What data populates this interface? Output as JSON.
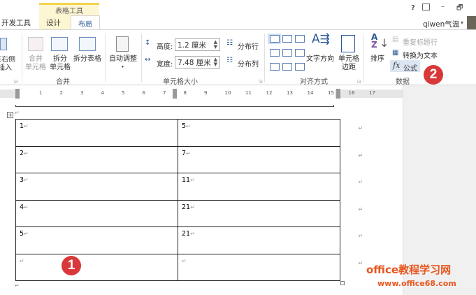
{
  "title_bar": {
    "help": "?",
    "restore_icon": "ribbon-display-icon",
    "minimize": "–",
    "maximize": "🗗",
    "user": "qiwen气温",
    "user_dropdown": "▾"
  },
  "contextual_tab": "表格工具",
  "tabs": [
    {
      "label": "开发工具"
    },
    {
      "label": "设计"
    },
    {
      "label": "布局",
      "selected": true
    }
  ],
  "ribbon": {
    "insert_label": "在右侧插入",
    "merge": {
      "merge_cells": "合并\n单元格",
      "split_cells_1": "拆分",
      "split_cells_2": "单元格",
      "split_table": "拆分表格",
      "group": "合并"
    },
    "cell_size": {
      "autofit": "自动调整",
      "height_label": "高度:",
      "height_value": "1.2 厘米",
      "width_label": "宽度:",
      "width_value": "7.48 厘米",
      "dist_rows": "分布行",
      "dist_cols": "分布列",
      "group": "单元格大小"
    },
    "alignment": {
      "text_direction": "文字方向",
      "cell_margins_1": "单元格",
      "cell_margins_2": "边距",
      "group": "对齐方式"
    },
    "data": {
      "sort": "排序",
      "repeat_header": "重复标题行",
      "convert_text": "转换为文本",
      "formula": "公式",
      "group": "数据"
    }
  },
  "ruler": {
    "numbers": [
      "1",
      "2",
      "3",
      "4",
      "5",
      "6",
      "7",
      "8",
      "9",
      "10",
      "11",
      "12",
      "13",
      "14",
      "15",
      "16",
      "17"
    ]
  },
  "table": {
    "rows": [
      [
        "1",
        "5"
      ],
      [
        "2",
        "7"
      ],
      [
        "3",
        "11"
      ],
      [
        "4",
        "21"
      ],
      [
        "5",
        "21"
      ],
      [
        "",
        ""
      ]
    ]
  },
  "paragraph_mark": "↵",
  "annotations": {
    "step1": "1",
    "step2": "2"
  },
  "watermark": {
    "name": "office教程学习网",
    "url": "www.office68.com"
  },
  "colors": {
    "accent": "#2b5797",
    "annotation": "#d9383a",
    "watermark": "#e8561f"
  }
}
